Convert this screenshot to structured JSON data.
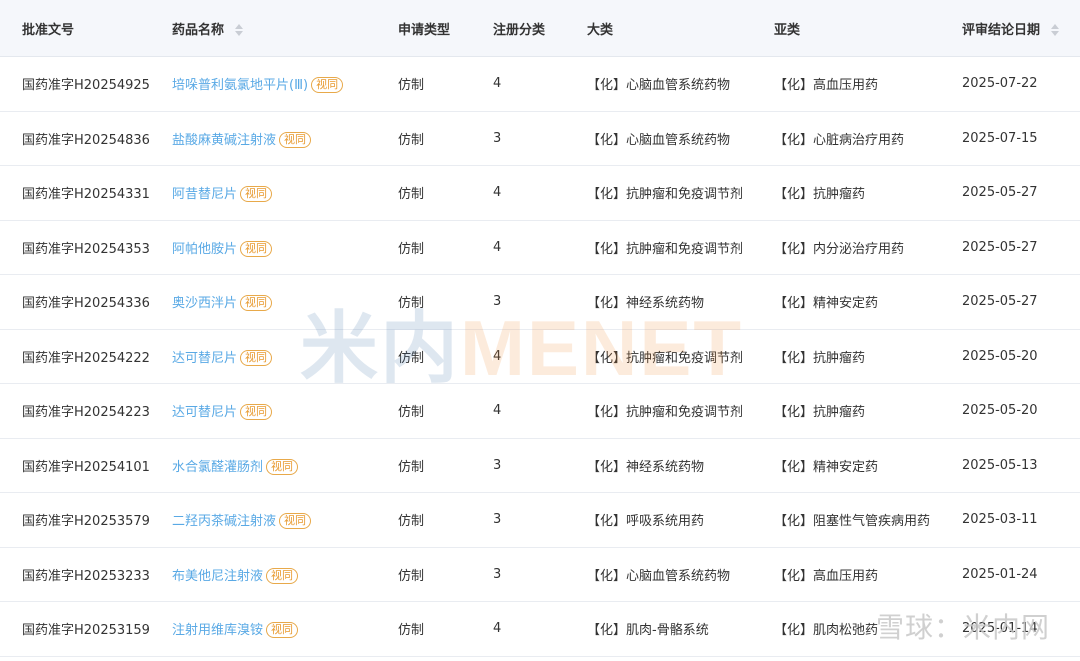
{
  "columns": {
    "approval_no": "批准文号",
    "drug_name": "药品名称",
    "apply_type": "申请类型",
    "reg_class": "注册分类",
    "category": "大类",
    "subcategory": "亚类",
    "review_date": "评审结论日期"
  },
  "tag_label": "视同",
  "rows": [
    {
      "approval_no": "国药准字H20254925",
      "drug_name": "培哚普利氨氯地平片(Ⅲ)",
      "apply_type": "仿制",
      "reg_class": "4",
      "category": "【化】心脑血管系统药物",
      "subcategory": "【化】高血压用药",
      "review_date": "2025-07-22"
    },
    {
      "approval_no": "国药准字H20254836",
      "drug_name": "盐酸麻黄碱注射液",
      "apply_type": "仿制",
      "reg_class": "3",
      "category": "【化】心脑血管系统药物",
      "subcategory": "【化】心脏病治疗用药",
      "review_date": "2025-07-15"
    },
    {
      "approval_no": "国药准字H20254331",
      "drug_name": "阿昔替尼片",
      "apply_type": "仿制",
      "reg_class": "4",
      "category": "【化】抗肿瘤和免疫调节剂",
      "subcategory": "【化】抗肿瘤药",
      "review_date": "2025-05-27"
    },
    {
      "approval_no": "国药准字H20254353",
      "drug_name": "阿帕他胺片",
      "apply_type": "仿制",
      "reg_class": "4",
      "category": "【化】抗肿瘤和免疫调节剂",
      "subcategory": "【化】内分泌治疗用药",
      "review_date": "2025-05-27"
    },
    {
      "approval_no": "国药准字H20254336",
      "drug_name": "奥沙西泮片",
      "apply_type": "仿制",
      "reg_class": "3",
      "category": "【化】神经系统药物",
      "subcategory": "【化】精神安定药",
      "review_date": "2025-05-27"
    },
    {
      "approval_no": "国药准字H20254222",
      "drug_name": "达可替尼片",
      "apply_type": "仿制",
      "reg_class": "4",
      "category": "【化】抗肿瘤和免疫调节剂",
      "subcategory": "【化】抗肿瘤药",
      "review_date": "2025-05-20"
    },
    {
      "approval_no": "国药准字H20254223",
      "drug_name": "达可替尼片",
      "apply_type": "仿制",
      "reg_class": "4",
      "category": "【化】抗肿瘤和免疫调节剂",
      "subcategory": "【化】抗肿瘤药",
      "review_date": "2025-05-20"
    },
    {
      "approval_no": "国药准字H20254101",
      "drug_name": "水合氯醛灌肠剂",
      "apply_type": "仿制",
      "reg_class": "3",
      "category": "【化】神经系统药物",
      "subcategory": "【化】精神安定药",
      "review_date": "2025-05-13"
    },
    {
      "approval_no": "国药准字H20253579",
      "drug_name": "二羟丙茶碱注射液",
      "apply_type": "仿制",
      "reg_class": "3",
      "category": "【化】呼吸系统用药",
      "subcategory": "【化】阻塞性气管疾病用药",
      "review_date": "2025-03-11"
    },
    {
      "approval_no": "国药准字H20253233",
      "drug_name": "布美他尼注射液",
      "apply_type": "仿制",
      "reg_class": "3",
      "category": "【化】心脑血管系统药物",
      "subcategory": "【化】高血压用药",
      "review_date": "2025-01-24"
    },
    {
      "approval_no": "国药准字H20253159",
      "drug_name": "注射用维库溴铵",
      "apply_type": "仿制",
      "reg_class": "4",
      "category": "【化】肌肉-骨骼系统",
      "subcategory": "【化】肌肉松弛药",
      "review_date": "2025-01-14"
    }
  ],
  "watermark": {
    "part1": "米内",
    "part2": "MENET"
  },
  "corner_watermark": "雪球：米内网",
  "colors": {
    "link": "#59a9e5",
    "tag": "#e89a2f",
    "header_bg": "#f5f7fb"
  }
}
